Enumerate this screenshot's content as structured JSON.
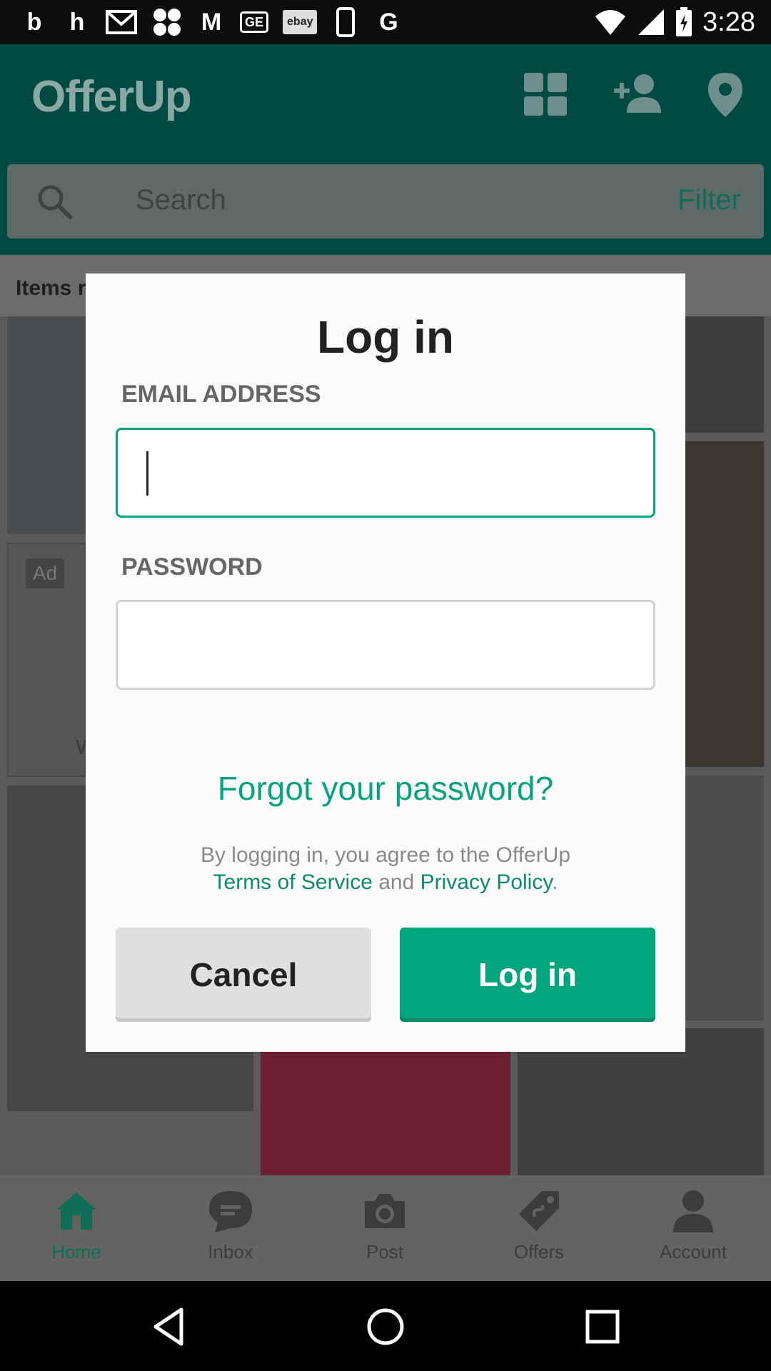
{
  "status_bar": {
    "time": "3:28",
    "notification_icons": [
      "beats-icon",
      "houzz-icon",
      "gmail-icon",
      "app-grid-icon",
      "moovit-icon",
      "ge-icon",
      "ebay-icon",
      "phone-icon",
      "google-icon"
    ],
    "ge_label": "GE",
    "ebay_label": "ebay"
  },
  "app_bar": {
    "logo": "OfferUp",
    "search_placeholder": "Search",
    "filter_label": "Filter"
  },
  "feed": {
    "title": "Items r",
    "ad_badge": "Ad",
    "partial_caption": "W"
  },
  "dialog": {
    "title": "Log in",
    "email_label": "EMAIL ADDRESS",
    "email_value": "",
    "password_label": "PASSWORD",
    "password_value": "",
    "forgot_link": "Forgot your password?",
    "terms_line1": "By logging in, you agree to the OfferUp",
    "terms_link": "Terms of Service",
    "terms_and": " and ",
    "privacy_link": "Privacy Policy",
    "terms_end": ".",
    "cancel_label": "Cancel",
    "login_label": "Log in"
  },
  "bottom_nav": {
    "items": [
      {
        "label": "Home",
        "icon": "home-icon",
        "active": true
      },
      {
        "label": "Inbox",
        "icon": "chat-icon",
        "active": false
      },
      {
        "label": "Post",
        "icon": "camera-icon",
        "active": false
      },
      {
        "label": "Offers",
        "icon": "tag-icon",
        "active": false
      },
      {
        "label": "Account",
        "icon": "person-icon",
        "active": false
      }
    ]
  },
  "colors": {
    "accent": "#02a57e",
    "app_bar": "#004a44",
    "focus_border": "#0aa37f"
  }
}
